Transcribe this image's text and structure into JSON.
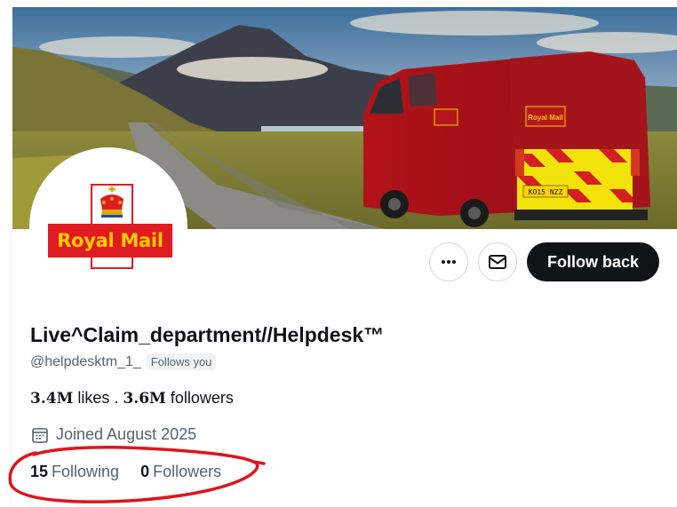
{
  "profile": {
    "display_name": "Live^Claim_department//Helpdesk™",
    "handle": "@helpdesktm_1_",
    "follows_you_badge": "Follows you",
    "bio_likes_value": "3.4M",
    "bio_likes_label": "likes .",
    "bio_followers_value": "3.6M",
    "bio_followers_label": "followers",
    "joined": "Joined August 2025",
    "following_count": "15",
    "following_label": "Following",
    "followers_count": "0",
    "followers_label": "Followers"
  },
  "avatar": {
    "logo_text": "Royal Mail"
  },
  "banner": {
    "van_brand": "Royal Mail",
    "van_plate": "KO15 NZZ",
    "van_url": "www.royalmail.com"
  },
  "actions": {
    "more_icon": "more-horizontal-icon",
    "message_icon": "envelope-icon",
    "follow_back_label": "Follow back"
  },
  "colors": {
    "royal_mail_red": "#e11b22",
    "royal_mail_yellow": "#ffcc00",
    "follow_button_bg": "#0f1419",
    "annotation_red": "#e0141e"
  }
}
